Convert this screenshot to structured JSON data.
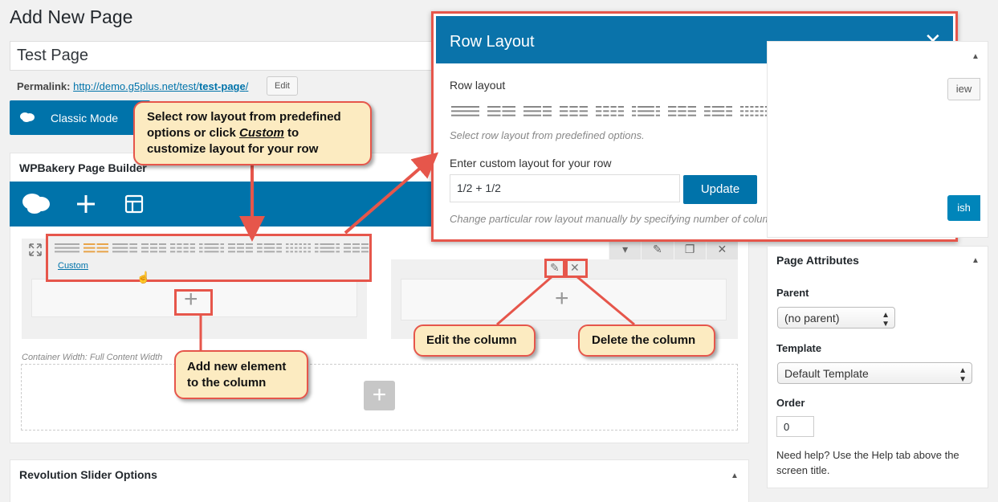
{
  "page": {
    "title": "Add New Page",
    "post_title": "Test Page"
  },
  "permalink": {
    "label": "Permalink:",
    "url_base": "http://demo.g5plus.net/test/",
    "url_slug": "test-page",
    "url_suffix": "/",
    "edit_label": "Edit"
  },
  "classic_mode": {
    "label": "Classic Mode"
  },
  "builder": {
    "title": "WPBakery Page Builder",
    "custom_link": "Custom",
    "container_width": "Container Width: Full Content Width"
  },
  "modal": {
    "title": "Row Layout",
    "row_layout_label": "Row layout",
    "predefined_hint": "Select row layout from predefined options.",
    "custom_label": "Enter custom layout for your row",
    "custom_value": "1/2 + 1/2",
    "update_label": "Update",
    "manual_hint": "Change particular row layout manually by specifying number of columns and their size value."
  },
  "publish_box": {
    "preview_fragment": "iew",
    "publish_fragment": "ish"
  },
  "page_attributes": {
    "title": "Page Attributes",
    "parent_label": "Parent",
    "parent_value": "(no parent)",
    "template_label": "Template",
    "template_value": "Default Template",
    "order_label": "Order",
    "order_value": "0",
    "help": "Need help? Use the Help tab above the screen title."
  },
  "revolution": {
    "title": "Revolution Slider Options"
  },
  "callouts": {
    "select_layout_pre": "Select row layout from predefined options or click ",
    "select_layout_em": "Custom",
    "select_layout_post": " to customize layout for your row",
    "add_element_line1": "Add new element",
    "add_element_line2": "to the column",
    "edit_column": "Edit the column",
    "delete_column": "Delete the column"
  },
  "colors": {
    "wp_blue": "#0073aa",
    "callout_fill": "#fcebc1",
    "highlight_red": "#e6564b"
  }
}
